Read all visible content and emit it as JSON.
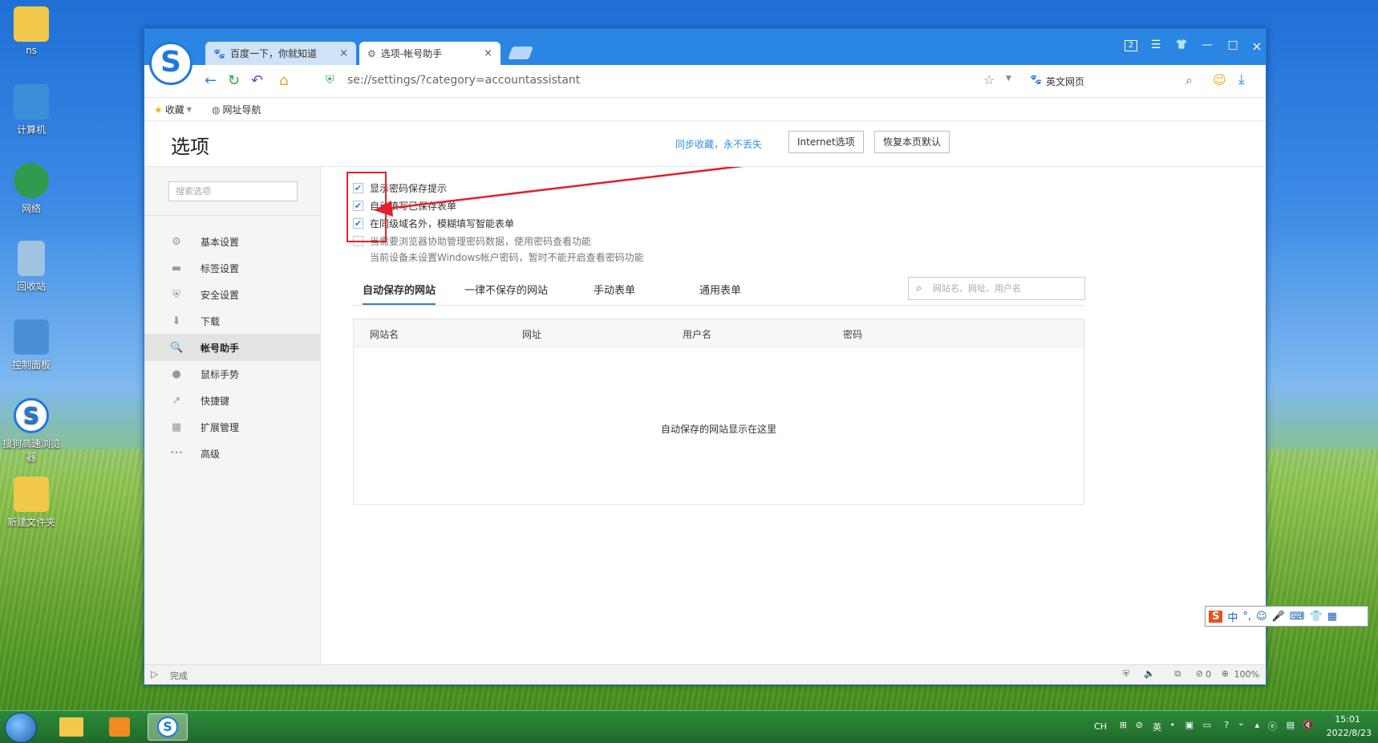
{
  "desktop": {
    "icons": [
      {
        "label": "ns",
        "icon": "folder-user-icon",
        "color": "#f2c94c"
      },
      {
        "label": "计算机",
        "icon": "computer-icon",
        "color": "#3b8fd9"
      },
      {
        "label": "网络",
        "icon": "network-icon",
        "color": "#2e9b50"
      },
      {
        "label": "回收站",
        "icon": "recycle-bin-icon",
        "color": "#9fc3e0"
      },
      {
        "label": "控制面板",
        "icon": "control-panel-icon",
        "color": "#4a90d9"
      },
      {
        "label": "搜狗高速浏览器",
        "icon": "sogou-browser-icon",
        "color": "#1f79dc"
      },
      {
        "label": "新建文件夹",
        "icon": "folder-icon",
        "color": "#f2c94c"
      }
    ]
  },
  "browser": {
    "logo_glyph": "S",
    "tabs": [
      {
        "title": "百度一下，你就知道",
        "icon": "baidu-paw-icon",
        "close": "×"
      },
      {
        "title": "选项-帐号助手",
        "icon": "gear-icon",
        "close": "×"
      }
    ],
    "window_controls": {
      "tab_count": "2",
      "menu": "☰",
      "skin": "👕",
      "minimize": "—",
      "maximize": "□",
      "close": "×"
    },
    "url": "se://settings/?category=accountassistant",
    "search_engine_label": "英文网页",
    "bookmarks": {
      "favorites": "收藏",
      "nav": "网址导航"
    }
  },
  "page": {
    "title": "选项",
    "sync_link": "同步收藏，永不丢失",
    "internet_options": "Internet选项",
    "restore_default": "恢复本页默认"
  },
  "sidebar": {
    "search_placeholder": "搜索选项",
    "items": [
      {
        "label": "基本设置",
        "icon": "gear-icon",
        "glyph": "⚙",
        "active": false
      },
      {
        "label": "标签设置",
        "icon": "tab-icon",
        "glyph": "▬",
        "active": false
      },
      {
        "label": "安全设置",
        "icon": "shield-icon",
        "glyph": "⛨",
        "active": false
      },
      {
        "label": "下载",
        "icon": "download-icon",
        "glyph": "⬇",
        "active": false
      },
      {
        "label": "帐号助手",
        "icon": "key-icon",
        "glyph": "🔍",
        "active": true
      },
      {
        "label": "鼠标手势",
        "icon": "mouse-icon",
        "glyph": "●",
        "active": false
      },
      {
        "label": "快捷键",
        "icon": "shortcut-icon",
        "glyph": "↗",
        "active": false
      },
      {
        "label": "扩展管理",
        "icon": "extensions-icon",
        "glyph": "▦",
        "active": false
      },
      {
        "label": "高级",
        "icon": "more-icon",
        "glyph": "•••",
        "active": false
      }
    ]
  },
  "options": [
    {
      "label": "显示密码保存提示",
      "checked": true
    },
    {
      "label": "自动填写已保存表单",
      "checked": true
    },
    {
      "label": "在同级域名外，模糊填写智能表单",
      "checked": true
    },
    {
      "label": "当需要浏览器协助管理密码数据，使用密码查看功能",
      "checked": false
    }
  ],
  "option_note": "当前设备未设置Windows帐户密码，暂时不能开启查看密码功能",
  "content_tabs": [
    {
      "label": "自动保存的网站",
      "active": true
    },
    {
      "label": "一律不保存的网站",
      "active": false
    },
    {
      "label": "手动表单",
      "active": false
    },
    {
      "label": "通用表单",
      "active": false
    }
  ],
  "site_search_placeholder": "网站名、网址、用户名",
  "table": {
    "columns": [
      "网站名",
      "网址",
      "用户名",
      "密码"
    ],
    "empty_message": "自动保存的网站显示在这里"
  },
  "statusbar": {
    "status": "完成",
    "count": "0",
    "zoom": "100%"
  },
  "taskbar": {
    "tray": {
      "lang": "CH",
      "ime_mode": "英",
      "time": "15:01",
      "date": "2022/8/23"
    }
  },
  "ime_toolbar": {
    "mode": "中",
    "punct": "°,"
  },
  "colors": {
    "accent": "#2a86e2",
    "highlight_red": "#e0222a",
    "link": "#2f8fe3"
  }
}
